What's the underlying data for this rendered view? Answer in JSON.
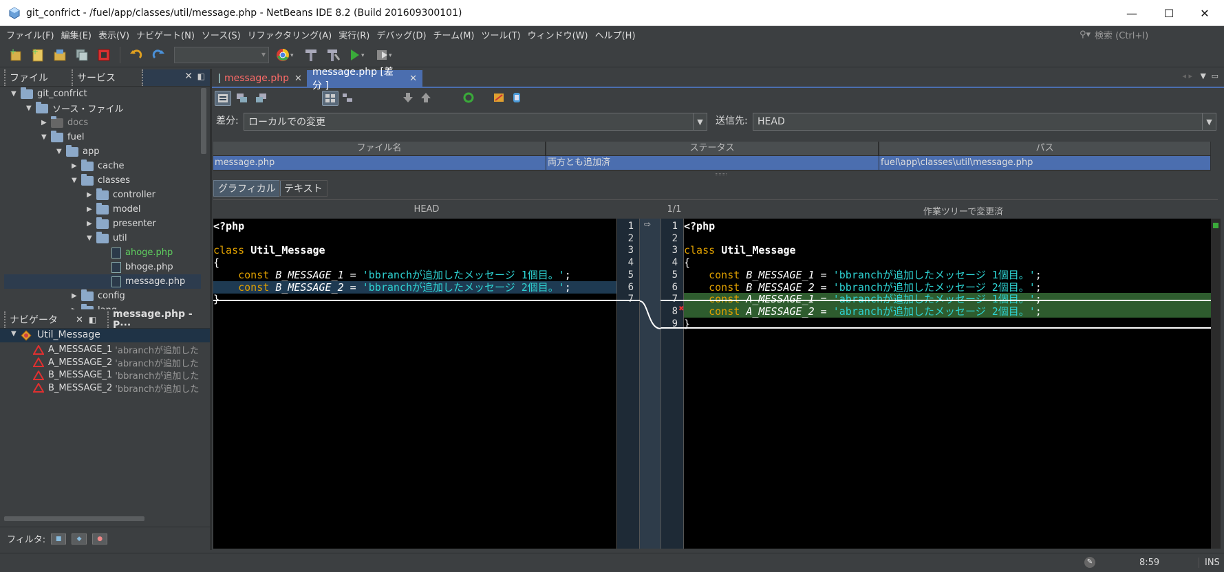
{
  "window": {
    "title": "git_confrict - /fuel/app/classes/util/message.php - NetBeans IDE 8.2 (Build 201609300101)",
    "minimize": "—",
    "maximize": "☐",
    "close": "✕"
  },
  "menu": [
    "ファイル(F)",
    "編集(E)",
    "表示(V)",
    "ナビゲート(N)",
    "ソース(S)",
    "リファクタリング(A)",
    "実行(R)",
    "デバッグ(D)",
    "チーム(M)",
    "ツール(T)",
    "ウィンドウ(W)",
    "ヘルプ(H)"
  ],
  "search": {
    "placeholder": "検索 (Ctrl+I)"
  },
  "toolbar": {
    "icons": [
      "new-project-icon",
      "new-file-icon",
      "open-project-icon",
      "close-project-icon",
      "stop-icon",
      "undo-icon",
      "redo-icon",
      "browser-icon",
      "build-icon",
      "clean-build-icon",
      "run-icon",
      "debug-icon"
    ],
    "config_value": ""
  },
  "left_tabs": {
    "files": "ファイル",
    "services": "サービス"
  },
  "project_tree": [
    {
      "label": "git_confrict",
      "level": 0,
      "expanded": true,
      "kind": "project"
    },
    {
      "label": "ソース・ファイル",
      "level": 1,
      "expanded": true,
      "kind": "source"
    },
    {
      "label": "docs",
      "level": 2,
      "expanded": false,
      "kind": "project-dim"
    },
    {
      "label": "fuel",
      "level": 2,
      "expanded": true,
      "kind": "folder"
    },
    {
      "label": "app",
      "level": 3,
      "expanded": true,
      "kind": "folder"
    },
    {
      "label": "cache",
      "level": 4,
      "expanded": false,
      "kind": "folder"
    },
    {
      "label": "classes",
      "level": 4,
      "expanded": true,
      "kind": "folder"
    },
    {
      "label": "controller",
      "level": 5,
      "expanded": false,
      "kind": "folder"
    },
    {
      "label": "model",
      "level": 5,
      "expanded": false,
      "kind": "folder"
    },
    {
      "label": "presenter",
      "level": 5,
      "expanded": false,
      "kind": "folder"
    },
    {
      "label": "util",
      "level": 5,
      "expanded": true,
      "kind": "folder"
    },
    {
      "label": "ahoge.php",
      "level": 6,
      "kind": "file-new"
    },
    {
      "label": "bhoge.php",
      "level": 6,
      "kind": "file"
    },
    {
      "label": "message.php",
      "level": 6,
      "kind": "file",
      "selected": true
    },
    {
      "label": "config",
      "level": 4,
      "expanded": false,
      "kind": "folder"
    },
    {
      "label": "lang",
      "level": 4,
      "expanded": false,
      "kind": "folder"
    }
  ],
  "navigator": {
    "tab": "ナビゲータ",
    "tab2": "message.php - P···",
    "root": "Util_Message",
    "items": [
      {
        "name": "A_MESSAGE_1",
        "value": "'abranchが追加した"
      },
      {
        "name": "A_MESSAGE_2",
        "value": "'abranchが追加した"
      },
      {
        "name": "B_MESSAGE_1",
        "value": "'bbranchが追加した"
      },
      {
        "name": "B_MESSAGE_2",
        "value": "'bbranchが追加した"
      }
    ],
    "filter_label": "フィルタ:"
  },
  "editor_tabs": [
    {
      "label": "message.php",
      "active": false,
      "modified": true
    },
    {
      "label": "message.php [差分 ]",
      "active": true
    }
  ],
  "diff": {
    "source_label": "差分:",
    "source_value": "ローカルでの変更",
    "target_label": "送信先:",
    "target_value": "HEAD",
    "table_headers": [
      "ファイル名",
      "ステータス",
      "パス"
    ],
    "table_row": [
      "message.php",
      "両方とも追加済",
      "fuel\\app\\classes\\util\\message.php"
    ],
    "view_tabs": [
      "グラフィカル",
      "テキスト"
    ],
    "left_title": "HEAD",
    "counter": "1/1",
    "right_title": "作業ツリーで変更済"
  },
  "left_code": [
    {
      "n": "1",
      "tokens": [
        {
          "t": "<?php",
          "c": "bold"
        }
      ]
    },
    {
      "n": "2",
      "tokens": []
    },
    {
      "n": "3",
      "tokens": [
        {
          "t": "class ",
          "c": "kw"
        },
        {
          "t": "Util_Message",
          "c": "bold"
        }
      ]
    },
    {
      "n": "4",
      "tokens": [
        {
          "t": "{",
          "c": "pl"
        }
      ]
    },
    {
      "n": "5",
      "tokens": [
        {
          "t": "    const ",
          "c": "kw"
        },
        {
          "t": "B_MESSAGE_1",
          "c": "cn"
        },
        {
          "t": " = ",
          "c": "pl"
        },
        {
          "t": "'bbranchが追加したメッセージ 1個目。'",
          "c": "st"
        },
        {
          "t": ";",
          "c": "pl"
        }
      ]
    },
    {
      "n": "6",
      "tokens": [
        {
          "t": "    const ",
          "c": "kw"
        },
        {
          "t": "B_MESSAGE_2",
          "c": "cn"
        },
        {
          "t": " = ",
          "c": "pl"
        },
        {
          "t": "'bbranchが追加したメッセージ 2個目。'",
          "c": "st"
        },
        {
          "t": ";",
          "c": "pl"
        }
      ]
    },
    {
      "n": "7",
      "tokens": [
        {
          "t": "}",
          "c": "pl"
        }
      ]
    }
  ],
  "right_code": [
    {
      "n": "1",
      "tokens": [
        {
          "t": "<?php",
          "c": "bold"
        }
      ]
    },
    {
      "n": "2",
      "tokens": []
    },
    {
      "n": "3",
      "tokens": [
        {
          "t": "class ",
          "c": "kw"
        },
        {
          "t": "Util_Message",
          "c": "bold"
        }
      ]
    },
    {
      "n": "4",
      "tokens": [
        {
          "t": "{",
          "c": "pl"
        }
      ]
    },
    {
      "n": "5",
      "tokens": [
        {
          "t": "    const ",
          "c": "kw"
        },
        {
          "t": "B_MESSAGE_1",
          "c": "cn"
        },
        {
          "t": " = ",
          "c": "pl"
        },
        {
          "t": "'bbranchが追加したメッセージ 1個目。'",
          "c": "st"
        },
        {
          "t": ";",
          "c": "pl"
        }
      ]
    },
    {
      "n": "6",
      "tokens": [
        {
          "t": "    const ",
          "c": "kw"
        },
        {
          "t": "B_MESSAGE_2",
          "c": "cn"
        },
        {
          "t": " = ",
          "c": "pl"
        },
        {
          "t": "'bbranchが追加したメッセージ 2個目。'",
          "c": "st"
        },
        {
          "t": ";",
          "c": "pl"
        }
      ]
    },
    {
      "n": "7",
      "added": true,
      "tokens": [
        {
          "t": "    const ",
          "c": "kw"
        },
        {
          "t": "A_MESSAGE_1",
          "c": "cn"
        },
        {
          "t": " = ",
          "c": "pl"
        },
        {
          "t": "'abranchが追加したメッセージ 1個目。'",
          "c": "st"
        },
        {
          "t": ";",
          "c": "pl"
        }
      ]
    },
    {
      "n": "8",
      "added": true,
      "tokens": [
        {
          "t": "    const ",
          "c": "kw"
        },
        {
          "t": "A_MESSAGE_2",
          "c": "cn"
        },
        {
          "t": " = ",
          "c": "pl"
        },
        {
          "t": "'abranchが追加したメッセージ 2個目。'",
          "c": "st"
        },
        {
          "t": ";",
          "c": "pl"
        }
      ]
    },
    {
      "n": "9",
      "tokens": [
        {
          "t": "}",
          "c": "pl"
        }
      ]
    }
  ],
  "status": {
    "time": "8:59",
    "mode": "INS"
  },
  "colors": {
    "added_bg": "#2e5c2e",
    "selected_row": "#4b6eaf",
    "accent": "#4b6eaf"
  }
}
